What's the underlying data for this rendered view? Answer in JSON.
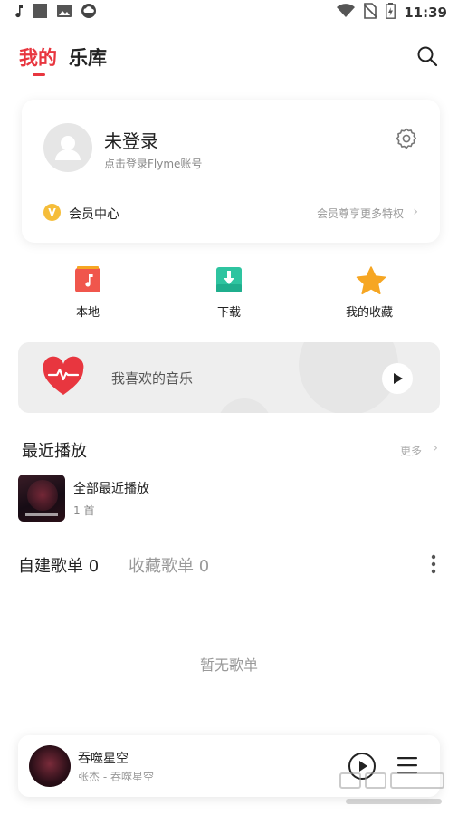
{
  "status_bar": {
    "time": "11:39",
    "left_icons": [
      "music-note-icon",
      "square-icon",
      "image-icon",
      "cloud-icon"
    ],
    "right_icons": [
      "wifi-icon",
      "no-sim-icon",
      "battery-icon"
    ]
  },
  "header": {
    "tabs": [
      {
        "label": "我的",
        "active": true
      },
      {
        "label": "乐库",
        "active": false
      }
    ],
    "search_icon": "search-icon"
  },
  "profile": {
    "title": "未登录",
    "subtitle": "点击登录Flyme账号",
    "settings_icon": "gear-icon",
    "vip_label": "会员中心",
    "vip_promo": "会员尊享更多特权"
  },
  "quick_entries": [
    {
      "label": "本地",
      "icon": "local-music-icon",
      "color": "#f0564c"
    },
    {
      "label": "下载",
      "icon": "download-icon",
      "color": "#2ec4a0"
    },
    {
      "label": "我的收藏",
      "icon": "star-icon",
      "color": "#f6a623"
    }
  ],
  "favorite": {
    "label": "我喜欢的音乐",
    "icon": "heart-pulse-icon"
  },
  "recent": {
    "title": "最近播放",
    "more": "更多",
    "items": [
      {
        "title": "全部最近播放",
        "count": "1 首"
      }
    ]
  },
  "playlists": {
    "tabs": [
      {
        "label": "自建歌单 0",
        "active": true
      },
      {
        "label": "收藏歌单 0",
        "active": false
      }
    ],
    "empty_text": "暂无歌单"
  },
  "player": {
    "title": "吞噬星空",
    "artist": "张杰 - 吞噬星空"
  },
  "colors": {
    "accent": "#e8363f",
    "vip_gold": "#f5bd3a"
  }
}
